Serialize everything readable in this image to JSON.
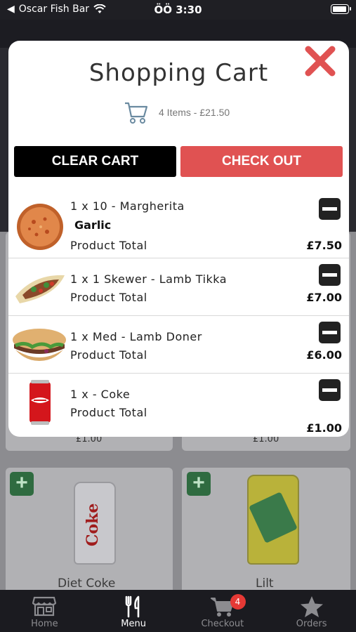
{
  "status_bar": {
    "back_app": "Oscar Fish Bar",
    "time": "ÖÖ 3:30"
  },
  "modal": {
    "title": "Shopping Cart",
    "summary": "4 Items - £21.50",
    "clear_label": "CLEAR CART",
    "checkout_label": "CHECK OUT",
    "items": [
      {
        "name": "1 x 10 - Margherita",
        "modifier": "Garlic",
        "total_label": "Product Total",
        "price": "£7.50",
        "image": "pizza"
      },
      {
        "name": "1 x 1 Skewer - Lamb Tikka",
        "total_label": "Product Total",
        "price": "£7.00",
        "image": "wrap"
      },
      {
        "name": "1 x Med - Lamb Doner",
        "total_label": "Product Total",
        "price": "£6.00",
        "image": "burger"
      },
      {
        "name": "1 x - Coke",
        "total_label": "Product Total",
        "price": "£1.00",
        "image": "coke-can"
      }
    ]
  },
  "background": {
    "price_left": "£1.00",
    "price_right": "£1.00",
    "product_left": "Diet Coke",
    "product_right": "Lilt"
  },
  "tabbar": {
    "tabs": [
      {
        "label": "Home",
        "icon": "store-icon"
      },
      {
        "label": "Menu",
        "icon": "cutlery-icon"
      },
      {
        "label": "Checkout",
        "icon": "cart-icon"
      },
      {
        "label": "Orders",
        "icon": "star-icon"
      }
    ],
    "checkout_badge": "4"
  },
  "colors": {
    "checkout": "#e05252",
    "clear": "#000000",
    "close": "#e05252",
    "add": "#2f6b40"
  }
}
